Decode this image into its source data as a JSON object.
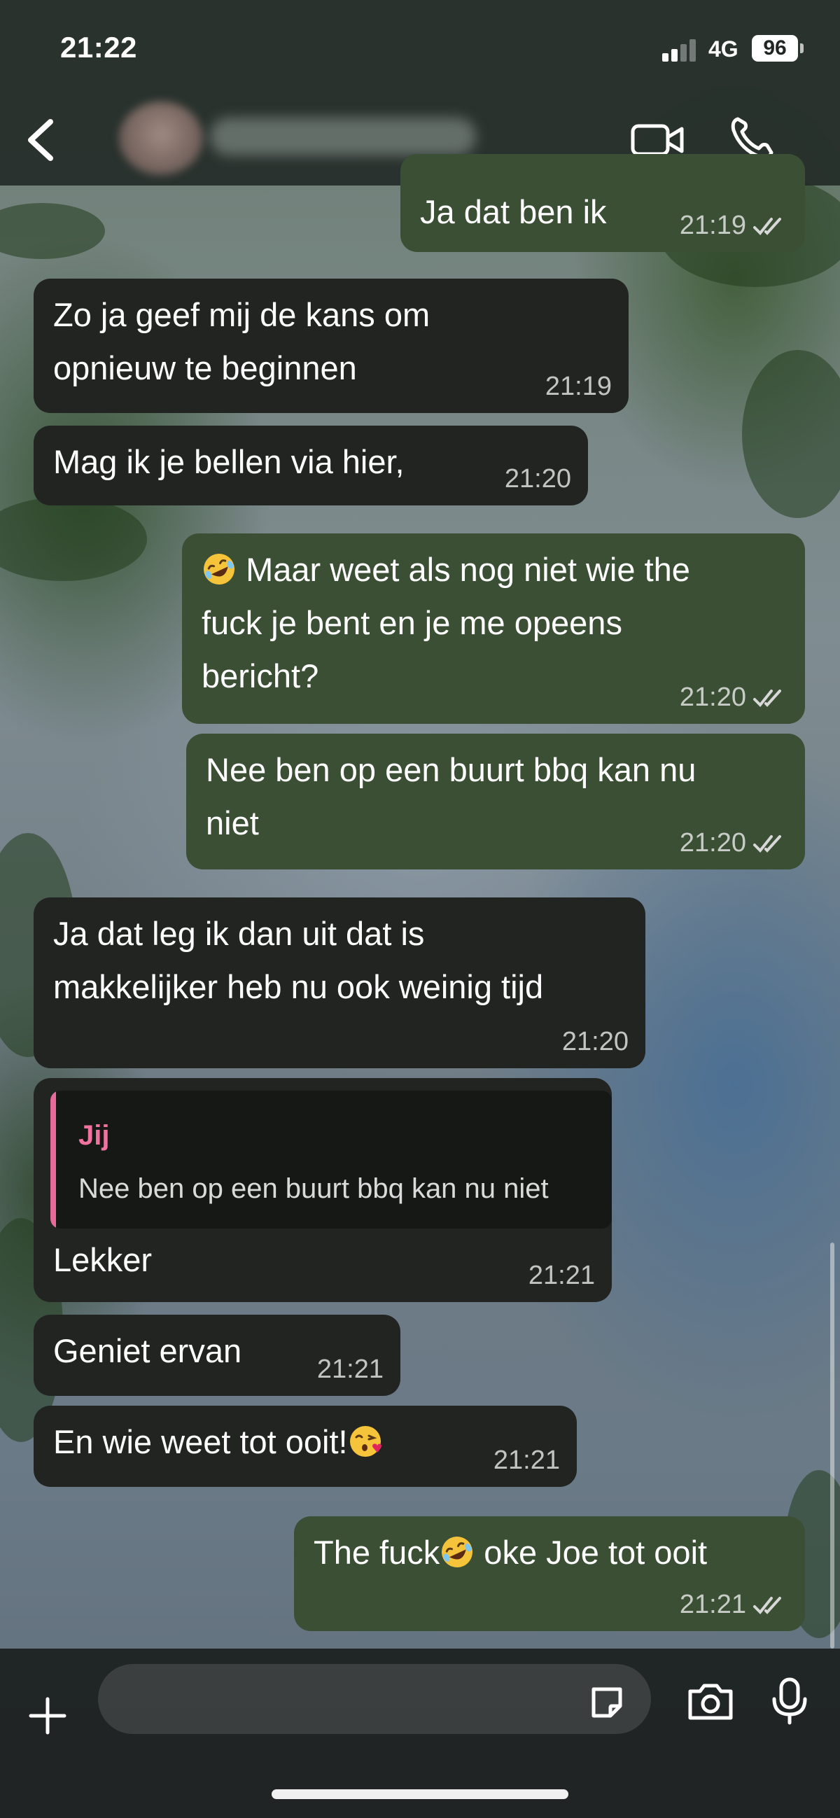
{
  "status_bar": {
    "time": "21:22",
    "network": "4G",
    "battery": "96"
  },
  "header": {
    "contact_name": "",
    "back_icon": "chevron-left-icon",
    "video_icon": "video-camera-icon",
    "phone_icon": "phone-icon"
  },
  "messages": [
    {
      "direction": "outgoing",
      "text": "Ja dat ben ik",
      "time": "21:19",
      "status": "read"
    },
    {
      "direction": "incoming",
      "lines": [
        "Zo ja geef mij de kans om",
        "opnieuw te beginnen"
      ],
      "time": "21:19"
    },
    {
      "direction": "incoming",
      "text": "Mag ik je bellen via hier,",
      "time": "21:20"
    },
    {
      "direction": "outgoing",
      "emoji": "rolling-on-floor-laughing",
      "lines": [
        "Maar weet als nog niet wie the",
        "fuck je bent en je me opeens",
        "bericht?"
      ],
      "time": "21:20",
      "status": "read"
    },
    {
      "direction": "outgoing",
      "lines": [
        "Nee ben op een buurt bbq kan nu",
        "niet"
      ],
      "time": "21:20",
      "status": "read"
    },
    {
      "direction": "incoming",
      "lines": [
        "Ja dat leg ik dan uit dat is",
        "makkelijker heb nu ook weinig tijd"
      ],
      "time": "21:20"
    },
    {
      "direction": "incoming",
      "reply_to": {
        "author": "Jij",
        "text": "Nee ben op een buurt bbq kan nu niet"
      },
      "text": "Lekker",
      "time": "21:21"
    },
    {
      "direction": "incoming",
      "text": "Geniet ervan",
      "time": "21:21"
    },
    {
      "direction": "incoming",
      "text": "En wie weet tot ooit!",
      "emoji": "face-blowing-a-kiss",
      "time": "21:21"
    },
    {
      "direction": "outgoing",
      "text_before_emoji": "The fuck",
      "emoji": "rolling-on-floor-laughing",
      "text_after_emoji": " oke Joe tot ooit",
      "time": "21:21",
      "status": "read"
    }
  ],
  "composer": {
    "placeholder": "",
    "icons": [
      "plus-icon",
      "sticker-icon",
      "camera-icon",
      "microphone-icon"
    ]
  },
  "colors": {
    "incoming_bubble": "#222422",
    "outgoing_bubble": "#3a4f33",
    "reply_accent": "#f0729e"
  }
}
